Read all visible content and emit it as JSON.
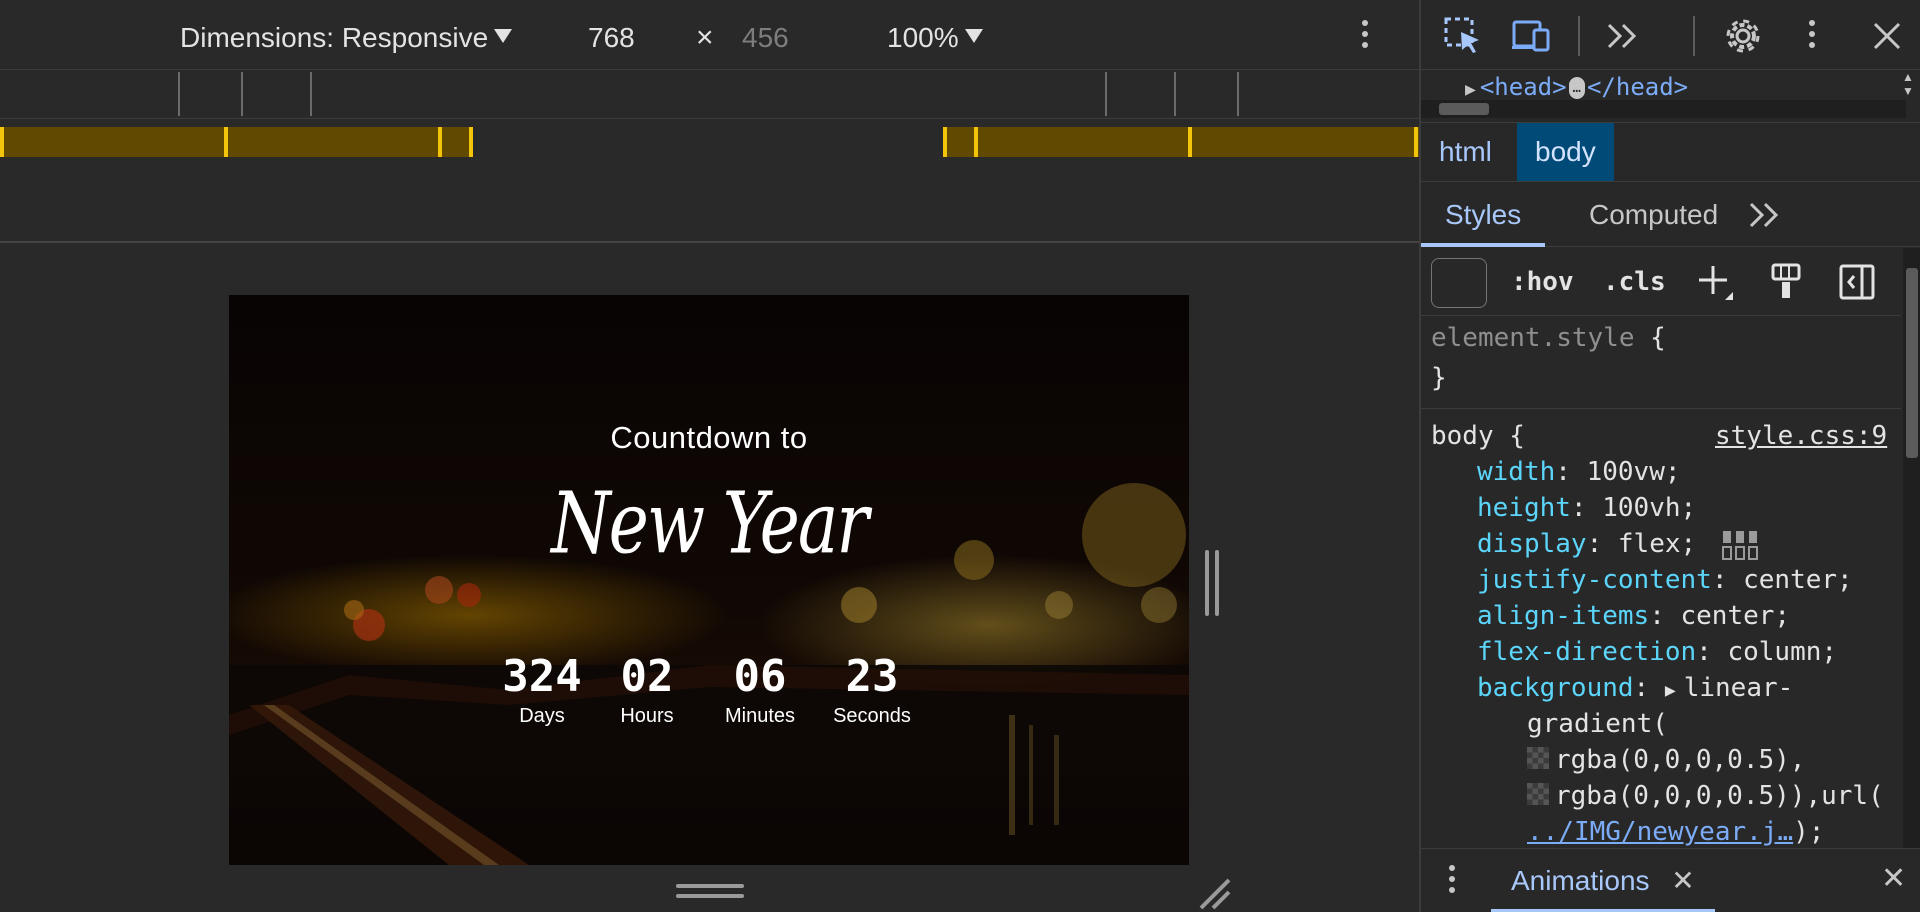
{
  "toolbar": {
    "dimensions_label": "Dimensions: Responsive",
    "width_value": "768",
    "times_sign": "×",
    "height_value": "456",
    "zoom_label": "100%"
  },
  "page": {
    "countdown_title": "Countdown to",
    "event_name": "New Year",
    "units": [
      {
        "value": "324",
        "label": "Days"
      },
      {
        "value": "02",
        "label": "Hours"
      },
      {
        "value": "06",
        "label": "Minutes"
      },
      {
        "value": "23",
        "label": "Seconds"
      }
    ]
  },
  "devtools": {
    "tree_line": {
      "open": "<head>",
      "ellipsis": "…",
      "close": "</head>"
    },
    "breadcrumbs": [
      "html",
      "body"
    ],
    "tabs": [
      "Styles",
      "Computed"
    ],
    "styles_toolbar": {
      "hov": ":hov",
      "cls": ".cls"
    },
    "element_style": {
      "selector": "element.style",
      "open": "{",
      "close": "}"
    },
    "body_rule": {
      "selector": "body",
      "open": "{",
      "source": "style.css:9",
      "decls": [
        {
          "prop": "width",
          "val": "100vw;"
        },
        {
          "prop": "height",
          "val": "100vh;"
        },
        {
          "prop": "display",
          "val": "flex;"
        },
        {
          "prop": "justify-content",
          "val": "center;"
        },
        {
          "prop": "align-items",
          "val": "center;"
        },
        {
          "prop": "flex-direction",
          "val": "column;"
        },
        {
          "prop": "background",
          "val": "linear-"
        }
      ],
      "bg_cont1": "gradient(",
      "bg_cont2": "rgba(0,0,0,0.5),",
      "bg_cont3": "rgba(0,0,0,0.5)),url(",
      "bg_cont4": "../IMG/newyear.j…",
      "bg_cont4_tail": ");"
    },
    "drawer_tab": "Animations"
  },
  "colors": {
    "breakpoint_fill": "#614a00",
    "breakpoint_mark": "#f2c40a",
    "accent": "#a8c7fa",
    "property": "#5cd5fb"
  }
}
